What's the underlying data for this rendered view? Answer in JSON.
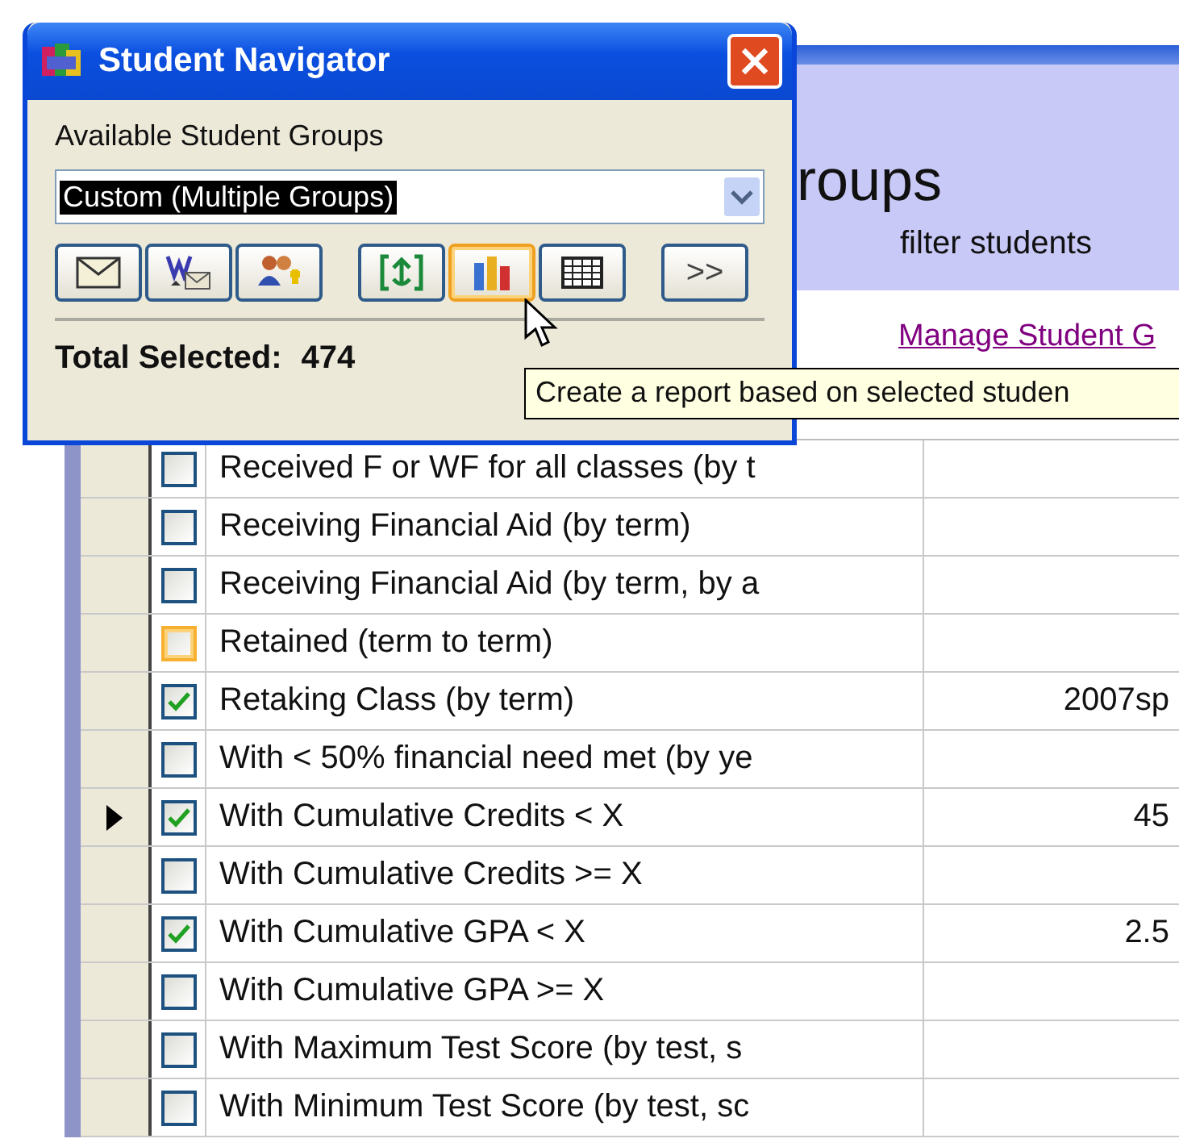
{
  "window": {
    "title": "Student Navigator"
  },
  "groups_label": "Available Student Groups",
  "group_select": {
    "value": "Custom (Multiple Groups)"
  },
  "toolbar_groups": [
    [
      {
        "kind": "envelope",
        "hover": false
      },
      {
        "kind": "word-mail",
        "hover": false
      },
      {
        "kind": "people-add",
        "hover": false
      }
    ],
    [
      {
        "kind": "export",
        "hover": false
      },
      {
        "kind": "chart",
        "hover": true
      },
      {
        "kind": "grid",
        "hover": false
      }
    ],
    [
      {
        "kind": "text",
        "label": ">>",
        "hover": false
      }
    ]
  ],
  "total": {
    "label": "Total Selected:",
    "value": "474"
  },
  "tooltip": "Create a report based on selected studen",
  "background": {
    "heading": "roups",
    "subheading": "filter students",
    "link": "Manage Student G"
  },
  "rows": [
    {
      "label": "Received F or WF for all classes (by t",
      "checked": false,
      "kind": "plain",
      "current": false
    },
    {
      "label": "Receiving Financial Aid (by term)",
      "checked": false,
      "kind": "plain",
      "current": false
    },
    {
      "label": "Receiving Financial Aid (by term, by a",
      "checked": false,
      "kind": "plain",
      "current": false
    },
    {
      "label": "Retained (term to term)",
      "checked": false,
      "kind": "focused",
      "current": false
    },
    {
      "label": "Retaking Class (by term)",
      "checked": true,
      "kind": "plain",
      "current": false,
      "value": "2007sp"
    },
    {
      "label": "With < 50% financial need met (by ye",
      "checked": false,
      "kind": "plain",
      "current": false
    },
    {
      "label": "With Cumulative Credits < X",
      "checked": true,
      "kind": "plain",
      "current": true,
      "value": "45"
    },
    {
      "label": "With Cumulative Credits >= X",
      "checked": false,
      "kind": "plain",
      "current": false
    },
    {
      "label": "With Cumulative GPA < X",
      "checked": true,
      "kind": "plain",
      "current": false,
      "value": "2.5"
    },
    {
      "label": "With Cumulative GPA >= X",
      "checked": false,
      "kind": "plain",
      "current": false
    },
    {
      "label": "With Maximum Test Score (by test, s",
      "checked": false,
      "kind": "plain",
      "current": false
    },
    {
      "label": "With Minimum Test Score (by test, sc",
      "checked": false,
      "kind": "plain",
      "current": false
    }
  ]
}
